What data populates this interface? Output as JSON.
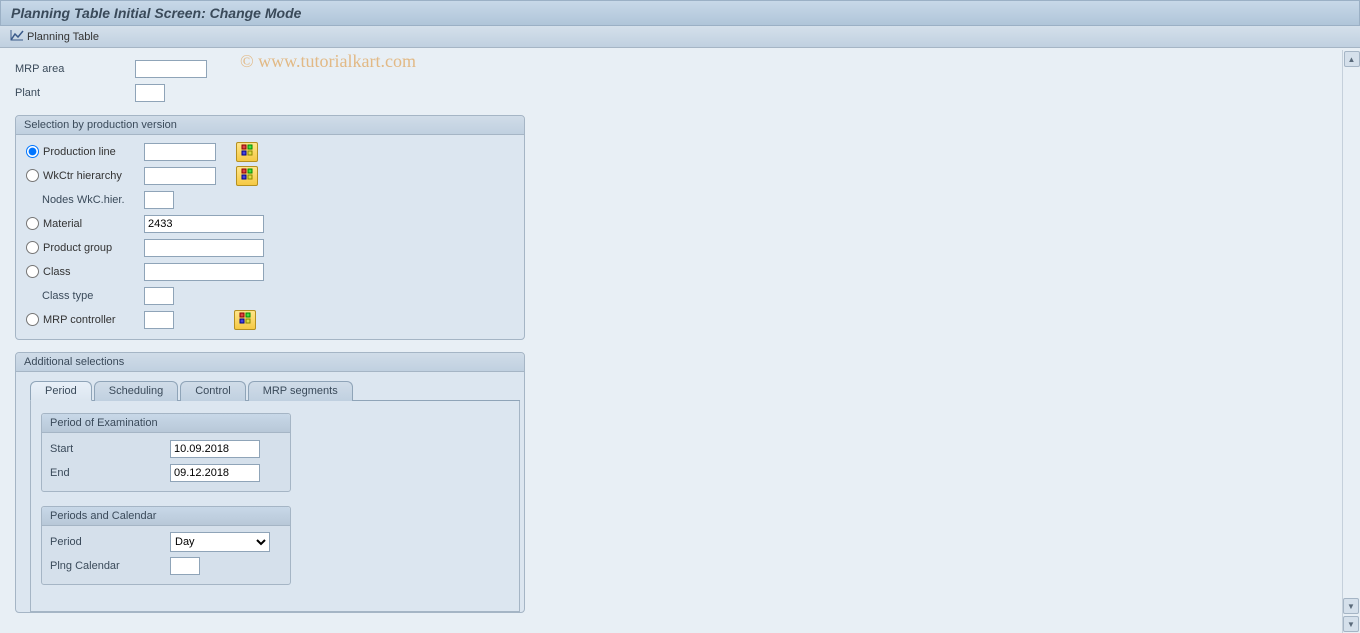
{
  "title": "Planning Table Initial Screen: Change Mode",
  "toolbar": {
    "planning_table": "Planning Table"
  },
  "watermark": "© www.tutorialkart.com",
  "fields": {
    "mrp_area_label": "MRP area",
    "mrp_area_value": "",
    "plant_label": "Plant",
    "plant_value": ""
  },
  "selection": {
    "title": "Selection by production version",
    "production_line_label": "Production line",
    "production_line_value": "",
    "wkctr_hierarchy_label": "WkCtr hierarchy",
    "wkctr_hierarchy_value": "",
    "nodes_label": "Nodes WkC.hier.",
    "nodes_value": "",
    "material_label": "Material",
    "material_value": "2433",
    "product_group_label": "Product group",
    "product_group_value": "",
    "class_label": "Class",
    "class_value": "",
    "class_type_label": "Class type",
    "class_type_value": "",
    "mrp_controller_label": "MRP controller",
    "mrp_controller_value": ""
  },
  "additional": {
    "title": "Additional selections",
    "tabs": {
      "period": "Period",
      "scheduling": "Scheduling",
      "control": "Control",
      "mrp_segments": "MRP segments"
    },
    "period_exam": {
      "title": "Period of Examination",
      "start_label": "Start",
      "start_value": "10.09.2018",
      "end_label": "End",
      "end_value": "09.12.2018"
    },
    "periods_cal": {
      "title": "Periods and Calendar",
      "period_label": "Period",
      "period_value": "Day",
      "calendar_label": "Plng Calendar",
      "calendar_value": ""
    }
  }
}
